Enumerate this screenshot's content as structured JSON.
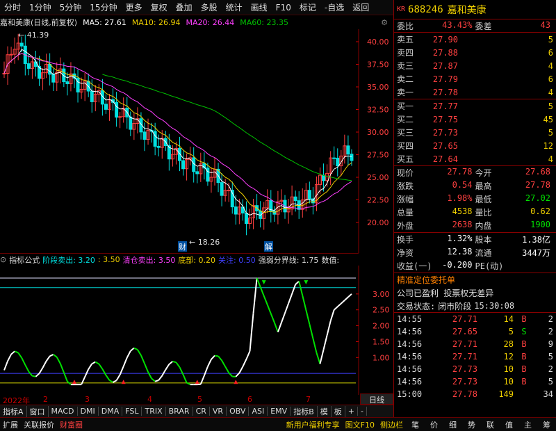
{
  "toolbar": {
    "items": [
      "分时",
      "1分钟",
      "5分钟",
      "15分钟",
      "更多",
      "复权",
      "叠加",
      "多股",
      "统计",
      "画线",
      "F10",
      "标记",
      "-自选",
      "返回"
    ]
  },
  "stock": {
    "code": "688246",
    "name": "嘉和美康",
    "market_badge": "KR"
  },
  "ma": {
    "title": "嘉和美康(日线,前复权)",
    "ma5": "MA5: 27.61",
    "ma10": "MA10: 26.94",
    "ma20": "MA20: 26.44",
    "ma60": "MA60: 23.35"
  },
  "main_axis": [
    "40.00",
    "37.50",
    "35.00",
    "32.50",
    "30.00",
    "27.50",
    "25.00",
    "22.50",
    "20.00"
  ],
  "annotations": {
    "high": "41.39",
    "low": "18.26",
    "cai": "财",
    "jie": "解"
  },
  "indicator": {
    "label": "指标公式",
    "s1": "阶段卖出: 3.20",
    "s2": ": 3.50",
    "s3": "清仓卖出: 3.50",
    "s4": "底部: 0.20",
    "s5": "关注: 0.50",
    "s6": "强弱分界线: 1.75",
    "s7": "数值:"
  },
  "ind_axis": [
    "3.00",
    "2.50",
    "2.00",
    "1.50",
    "1.00"
  ],
  "dates": [
    "2022年",
    "2",
    "3",
    "4",
    "5",
    "6",
    "7"
  ],
  "tabs": [
    "指标A",
    "窗口",
    "MACD",
    "DMI",
    "DMA",
    "FSL",
    "TRIX",
    "BRAR",
    "CR",
    "VR",
    "OBV",
    "ASI",
    "EMV",
    "",
    "指标B",
    "模",
    "板",
    "+",
    "-"
  ],
  "bottom": {
    "left": [
      "扩展",
      "关联报价",
      "财富圈"
    ],
    "mid": [
      "新用户福利专享",
      "图文F10",
      "侧边栏"
    ],
    "right": [
      "笔",
      "价",
      "细",
      "势",
      "联",
      "值",
      "主",
      "筹"
    ],
    "period": "日线"
  },
  "quote": {
    "weibi_label": "委比",
    "weibi": "43.43%",
    "weicha_label": "委差",
    "weicha": "43",
    "asks": [
      {
        "l": "卖五",
        "p": "27.90",
        "v": "5"
      },
      {
        "l": "卖四",
        "p": "27.88",
        "v": "6"
      },
      {
        "l": "卖三",
        "p": "27.87",
        "v": "4"
      },
      {
        "l": "卖二",
        "p": "27.79",
        "v": "6"
      },
      {
        "l": "卖一",
        "p": "27.78",
        "v": "4"
      }
    ],
    "bids": [
      {
        "l": "买一",
        "p": "27.77",
        "v": "5"
      },
      {
        "l": "买二",
        "p": "27.75",
        "v": "45"
      },
      {
        "l": "买三",
        "p": "27.73",
        "v": "5"
      },
      {
        "l": "买四",
        "p": "27.65",
        "v": "12"
      },
      {
        "l": "买五",
        "p": "27.64",
        "v": "4"
      }
    ],
    "stats": [
      {
        "k1": "现价",
        "v1": "27.78",
        "k2": "今开",
        "v2": "27.68"
      },
      {
        "k1": "涨跌",
        "v1": "0.54",
        "k2": "最高",
        "v2": "27.78"
      },
      {
        "k1": "涨幅",
        "v1": "1.98%",
        "k2": "最低",
        "v2": "27.02"
      },
      {
        "k1": "总量",
        "v1": "4538",
        "k2": "量比",
        "v2": "0.62"
      },
      {
        "k1": "外盘",
        "v1": "2638",
        "k2": "内盘",
        "v2": "1900"
      }
    ],
    "stats2": [
      {
        "k1": "换手",
        "v1": "1.32%",
        "k2": "股本",
        "v2": "1.38亿"
      },
      {
        "k1": "净资",
        "v1": "12.38",
        "k2": "流通",
        "v2": "3447万"
      },
      {
        "k1": "收益(一)",
        "v1": "-0.200",
        "k2": "PE(动)",
        "v2": ""
      }
    ],
    "info1": "精准定位委托单",
    "info2": "公司已盈利 投票权无差异",
    "status_label": "交易状态:",
    "status": "闭市阶段",
    "status_time": "15:30:08",
    "ticks": [
      {
        "t": "14:55",
        "p": "27.71",
        "v": "14",
        "d": "B",
        "n": "2"
      },
      {
        "t": "14:56",
        "p": "27.65",
        "v": "5",
        "d": "S",
        "n": "2"
      },
      {
        "t": "14:56",
        "p": "27.71",
        "v": "28",
        "d": "B",
        "n": "9"
      },
      {
        "t": "14:56",
        "p": "27.71",
        "v": "12",
        "d": "B",
        "n": "5"
      },
      {
        "t": "14:56",
        "p": "27.73",
        "v": "10",
        "d": "B",
        "n": "2"
      },
      {
        "t": "14:56",
        "p": "27.73",
        "v": "10",
        "d": "B",
        "n": "5"
      },
      {
        "t": "15:00",
        "p": "27.78",
        "v": "149",
        "d": "",
        "n": "34"
      }
    ]
  },
  "colors": {
    "up": "#ff4040",
    "down": "#00e0e0",
    "ma5": "#ffffff",
    "ma10": "#f0d000",
    "ma20": "#ff40ff",
    "ma60": "#00c000"
  }
}
